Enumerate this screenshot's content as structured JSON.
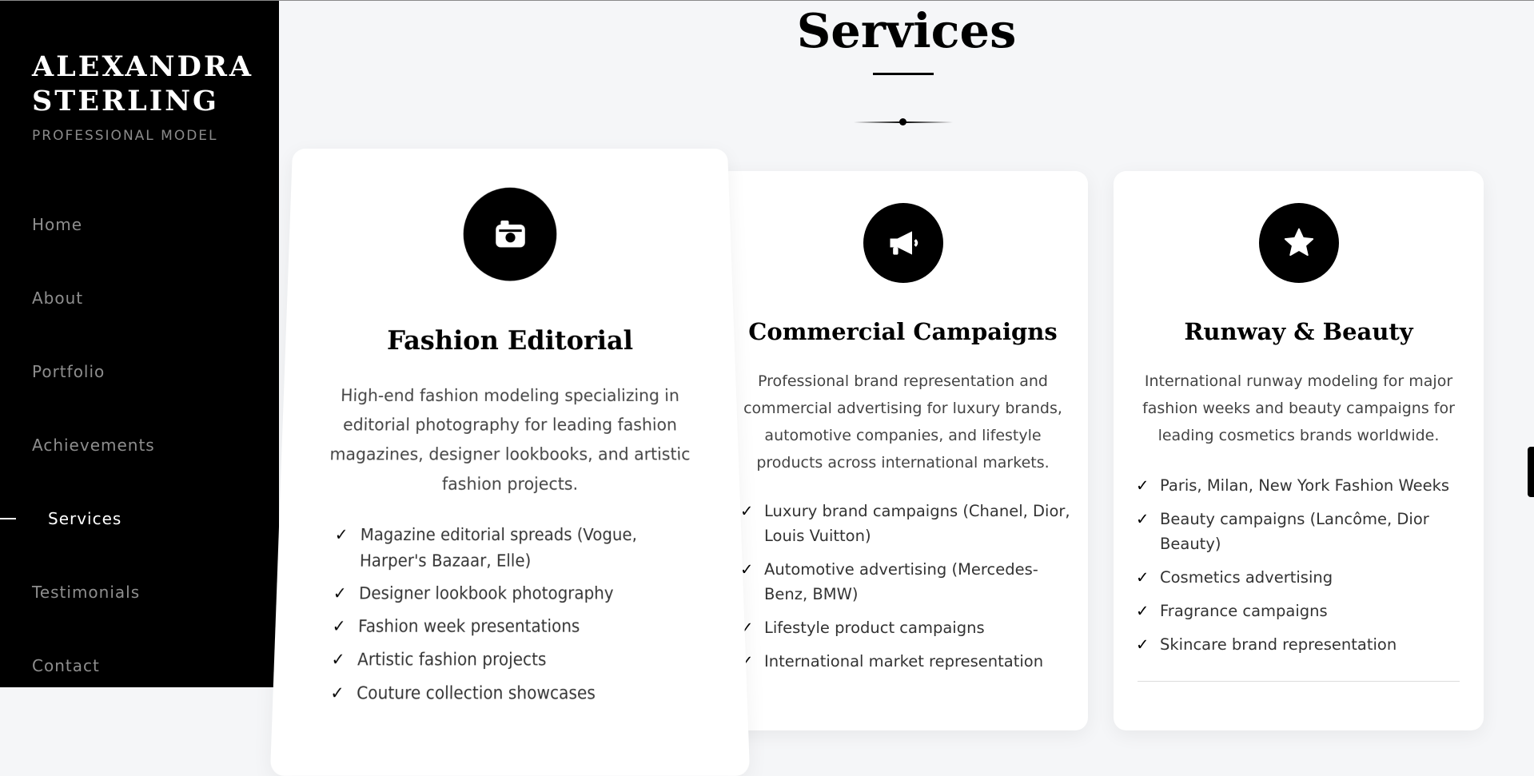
{
  "sidebar": {
    "brand_name": "ALEXANDRA STERLING",
    "brand_subtitle": "PROFESSIONAL MODEL",
    "nav": [
      {
        "label": "Home"
      },
      {
        "label": "About"
      },
      {
        "label": "Portfolio"
      },
      {
        "label": "Achievements"
      },
      {
        "label": "Services",
        "active": true
      },
      {
        "label": "Testimonials"
      },
      {
        "label": "Contact"
      }
    ]
  },
  "services": {
    "title": "Services",
    "cards": [
      {
        "icon": "camera-icon",
        "title": "Fashion Editorial",
        "description": "High-end fashion modeling specializing in editorial photography for leading fashion magazines, designer lookbooks, and artistic fashion projects.",
        "features": [
          "Magazine editorial spreads (Vogue, Harper's Bazaar, Elle)",
          "Designer lookbook photography",
          "Fashion week presentations",
          "Artistic fashion projects",
          "Couture collection showcases"
        ]
      },
      {
        "icon": "megaphone-icon",
        "title": "Commercial Campaigns",
        "description": "Professional brand representation and commercial advertising for luxury brands, automotive companies, and lifestyle products across international markets.",
        "features": [
          "Luxury brand campaigns (Chanel, Dior, Louis Vuitton)",
          "Automotive advertising (Mercedes-Benz, BMW)",
          "Lifestyle product campaigns",
          "International market representation"
        ]
      },
      {
        "icon": "star-icon",
        "title": "Runway & Beauty",
        "description": "International runway modeling for major fashion weeks and beauty campaigns for leading cosmetics brands worldwide.",
        "features": [
          "Paris, Milan, New York Fashion Weeks",
          "Beauty campaigns (Lancôme, Dior Beauty)",
          "Cosmetics advertising",
          "Fragrance campaigns",
          "Skincare brand representation"
        ]
      }
    ],
    "check_glyph": "✓"
  },
  "colors": {
    "sidebar_bg": "#000000",
    "page_bg": "#f5f6f8",
    "accent": "#000000",
    "nav_inactive": "#8e8e8e"
  }
}
